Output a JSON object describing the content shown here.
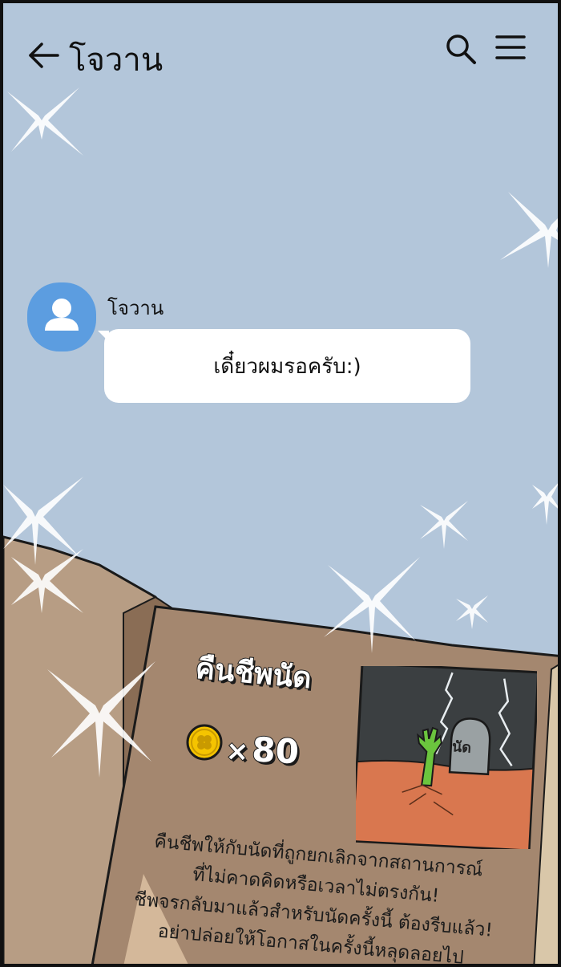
{
  "header": {
    "title": "โจวาน",
    "back_icon": "arrow-left-icon",
    "search_icon": "search-icon",
    "menu_icon": "hamburger-menu-icon"
  },
  "chat": {
    "sender": "โจวาน",
    "avatar_icon": "user-silhouette-icon",
    "message": "เดี๋ยวผมรอครับ:)"
  },
  "book": {
    "title": "คืนชีพนัด",
    "cost_symbol": "×",
    "cost_value": "80",
    "coin_icon": "clover-coin-icon",
    "tombstone_label": "นัด",
    "description": [
      "คืนชีพให้กับนัดที่ถูกยกเลิกจากสถานการณ์",
      "ที่ไม่คาดคิดหรือเวลาไม่ตรงกัน!",
      "ชีพจรกลับมาแล้วสำหรับนัดครั้งนี้ ต้องรีบแล้ว!",
      "อย่าปล่อยให้โอกาสในครั้งนี้หลุดลอยไป"
    ]
  },
  "colors": {
    "sky": "#b3c6da",
    "avatar": "#5c9de0",
    "page": "#a4876f",
    "page_left": "#b79d84",
    "book_edge": "#8a6d55",
    "ground": "#d9774f",
    "storm_sky": "#3b3f41",
    "tombstone": "#9aa1a3",
    "zombie_hand": "#6bc53e",
    "coin": "#f5c400"
  }
}
